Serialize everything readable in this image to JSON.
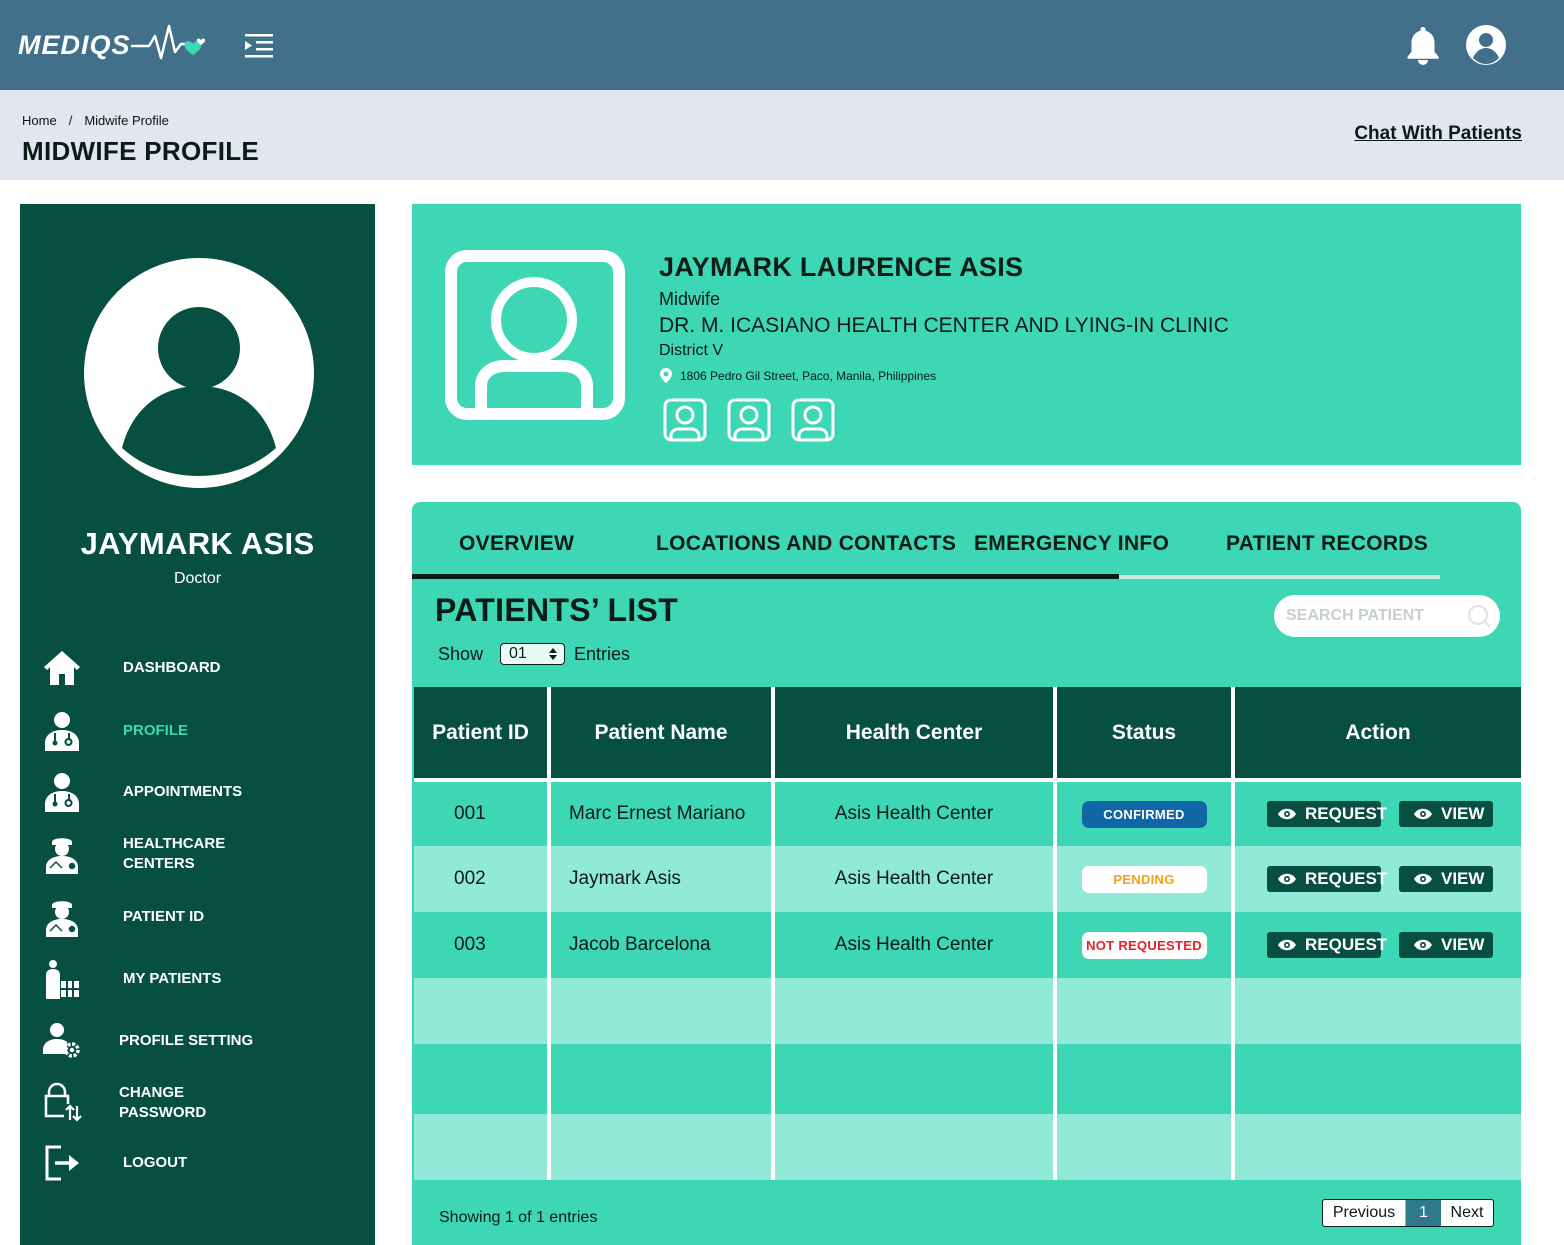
{
  "app": {
    "logo_text": "MEDIQS"
  },
  "header": {
    "breadcrumb": {
      "home": "Home",
      "separator": "/",
      "current": "Midwife Profile"
    },
    "page_title": "MIDWIFE PROFILE",
    "chat_link": "Chat With Patients"
  },
  "sidebar": {
    "user_name": "JAYMARK ASIS",
    "user_role": "Doctor",
    "items": [
      {
        "label": "DASHBOARD",
        "icon": "home-icon"
      },
      {
        "label": "PROFILE",
        "icon": "doctor-icon",
        "active": true
      },
      {
        "label": "APPOINTMENTS",
        "icon": "doctor-icon"
      },
      {
        "label": "HEALTHCARE",
        "label2": "CENTERS",
        "icon": "nurse-icon"
      },
      {
        "label": "PATIENT ID",
        "icon": "nurse-icon"
      },
      {
        "label": "MY PATIENTS",
        "icon": "patients-icon"
      },
      {
        "label": "PROFILE SETTING",
        "icon": "user-gear-icon"
      },
      {
        "label": "CHANGE",
        "label2": "PASSWORD",
        "icon": "lock-icon"
      },
      {
        "label": "LOGOUT",
        "icon": "logout-icon"
      }
    ]
  },
  "profile": {
    "name": "JAYMARK LAURENCE ASIS",
    "role": "Midwife",
    "center": "DR. M. ICASIANO HEALTH CENTER AND LYING-IN CLINIC",
    "district": "District V",
    "address": "1806 Pedro Gil Street, Paco, Manila, Philippines"
  },
  "tabs": [
    {
      "label": "OVERVIEW"
    },
    {
      "label": "LOCATIONS AND CONTACTS"
    },
    {
      "label": "EMERGENCY INFO"
    },
    {
      "label": "PATIENT RECORDS"
    }
  ],
  "patients_list": {
    "title": "PATIENTS’ LIST",
    "show_label": "Show",
    "entries_value": "01",
    "entries_label": "Entries",
    "search_placeholder": "SEARCH PATIENT",
    "columns": [
      "Patient ID",
      "Patient Name",
      "Health Center",
      "Status",
      "Action"
    ],
    "rows": [
      {
        "id": "001",
        "name": "Marc Ernest Mariano",
        "center": "Asis Health Center",
        "status": "CONFIRMED"
      },
      {
        "id": "002",
        "name": "Jaymark Asis",
        "center": "Asis Health Center",
        "status": "PENDING"
      },
      {
        "id": "003",
        "name": "Jacob Barcelona",
        "center": "Asis Health Center",
        "status": "NOT REQUESTED"
      }
    ],
    "request_label": "REQUEST",
    "view_label": "VIEW",
    "footer_text": "Showing 1 of 1 entries",
    "pager": {
      "previous": "Previous",
      "page": "1",
      "next": "Next"
    }
  },
  "colors": {
    "topbar": "#42708a",
    "sidebar": "#074f41",
    "accent": "#3ed7b5",
    "row_light": "#91ead8",
    "confirmed": "#1167a6",
    "pending": "#f2a11a",
    "not_requested": "#e5202a"
  }
}
